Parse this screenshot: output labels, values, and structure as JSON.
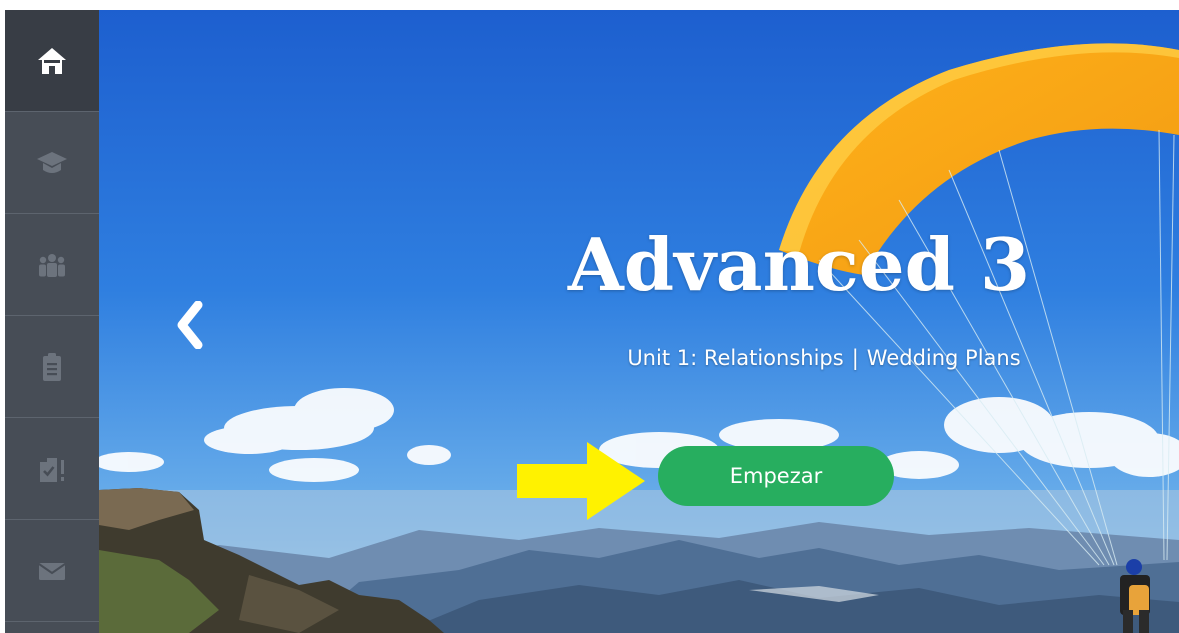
{
  "sidebar": {
    "items": [
      {
        "icon": "home-icon",
        "active": true
      },
      {
        "icon": "graduation-cap-icon",
        "active": false
      },
      {
        "icon": "group-icon",
        "active": false
      },
      {
        "icon": "clipboard-icon",
        "active": false
      },
      {
        "icon": "tasks-icon",
        "active": false
      },
      {
        "icon": "envelope-icon",
        "active": false
      }
    ]
  },
  "hero": {
    "title": "Advanced 3",
    "unit": "Unit 1: Relationships",
    "separator": "|",
    "lesson": "Wedding Plans",
    "start_button": "Empezar",
    "prev_icon": "chevron-left-icon",
    "pointer_icon": "arrow-right-icon"
  },
  "colors": {
    "sidebar_bg": "#474d56",
    "sidebar_active_bg": "#383d45",
    "button_green": "#27ae5f",
    "arrow_yellow": "#fff200",
    "paraglider_orange": "#f5a623"
  }
}
